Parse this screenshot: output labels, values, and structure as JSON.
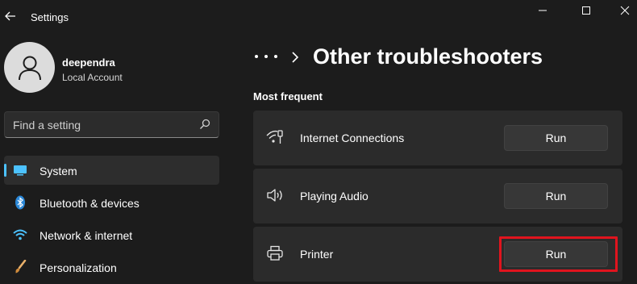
{
  "app": {
    "title": "Settings"
  },
  "window_controls": [
    "minimize",
    "maximize",
    "close"
  ],
  "account": {
    "name": "deependra",
    "type": "Local Account"
  },
  "search": {
    "placeholder": "Find a setting"
  },
  "nav": {
    "items": [
      {
        "label": "System",
        "icon": "monitor-icon",
        "active": true
      },
      {
        "label": "Bluetooth & devices",
        "icon": "bluetooth-icon",
        "active": false
      },
      {
        "label": "Network & internet",
        "icon": "wifi-icon",
        "active": false
      },
      {
        "label": "Personalization",
        "icon": "brush-icon",
        "active": false
      }
    ]
  },
  "header": {
    "title": "Other troubleshooters"
  },
  "section": {
    "title": "Most frequent"
  },
  "troubleshooters": [
    {
      "label": "Internet Connections",
      "icon": "wifi-icon",
      "button": "Run"
    },
    {
      "label": "Playing Audio",
      "icon": "speaker-icon",
      "button": "Run"
    },
    {
      "label": "Printer",
      "icon": "printer-icon",
      "button": "Run",
      "highlighted": true
    }
  ],
  "colors": {
    "accent": "#4cc2ff",
    "highlight": "#e0141e",
    "background": "#1c1c1c",
    "card": "#2b2b2b"
  }
}
